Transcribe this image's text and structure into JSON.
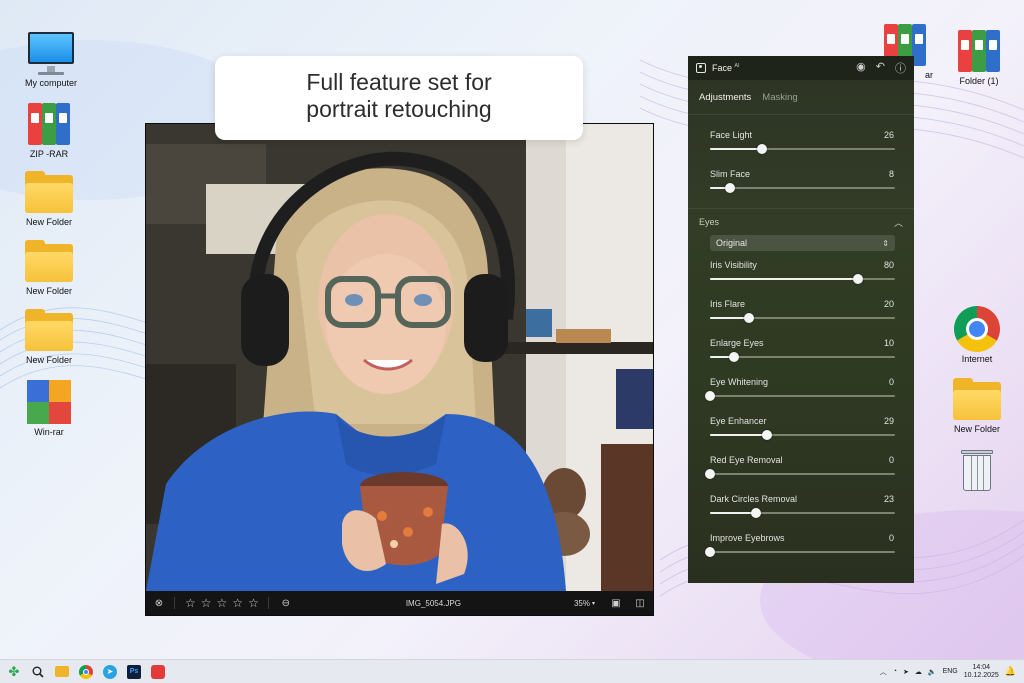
{
  "callout": {
    "line1": "Full feature set for",
    "line2": "portrait retouching"
  },
  "desktop_left": [
    {
      "label": "My computer",
      "icon": "monitor-icon"
    },
    {
      "label": "ZIP -RAR",
      "icon": "binder-icon"
    },
    {
      "label": "New Folder",
      "icon": "folder-icon"
    },
    {
      "label": "New Folder",
      "icon": "folder-icon"
    },
    {
      "label": "New Folder",
      "icon": "folder-icon"
    },
    {
      "label": "Win-rar",
      "icon": "winrar-icon"
    }
  ],
  "desktop_right": [
    {
      "label": "ar",
      "icon": "binder-icon"
    },
    {
      "label": "Folder (1)",
      "icon": "binder-icon"
    },
    {
      "label": "Internet",
      "icon": "chrome-icon"
    },
    {
      "label": "New Folder",
      "icon": "folder-icon"
    },
    {
      "label": "",
      "icon": "recycle-bin-icon"
    }
  ],
  "viewer": {
    "filename": "IMG_5054.JPG",
    "zoom": "35%",
    "rating_stars": 5
  },
  "panel": {
    "title": "Face",
    "title_badge": "AI",
    "tabs": [
      {
        "label": "Adjustments",
        "active": true
      },
      {
        "label": "Masking",
        "active": false
      }
    ],
    "face_sliders": [
      {
        "label": "Face Light",
        "value": 26,
        "fraction": 0.28
      },
      {
        "label": "Slim Face",
        "value": 8,
        "fraction": 0.11
      }
    ],
    "eyes_section": "Eyes",
    "eyes_mode": "Original",
    "eye_sliders": [
      {
        "label": "Iris Visibility",
        "value": 80,
        "fraction": 0.8
      },
      {
        "label": "Iris Flare",
        "value": 20,
        "fraction": 0.21
      },
      {
        "label": "Enlarge Eyes",
        "value": 10,
        "fraction": 0.13
      },
      {
        "label": "Eye Whitening",
        "value": 0,
        "fraction": 0.0
      },
      {
        "label": "Eye Enhancer",
        "value": 29,
        "fraction": 0.31
      },
      {
        "label": "Red Eye Removal",
        "value": 0,
        "fraction": 0.0
      },
      {
        "label": "Dark Circles Removal",
        "value": 23,
        "fraction": 0.25
      },
      {
        "label": "Improve Eyebrows",
        "value": 0,
        "fraction": 0.0
      }
    ]
  },
  "taskbar": {
    "language": "ENG",
    "time": "14:04",
    "date": "10.12.2025"
  }
}
